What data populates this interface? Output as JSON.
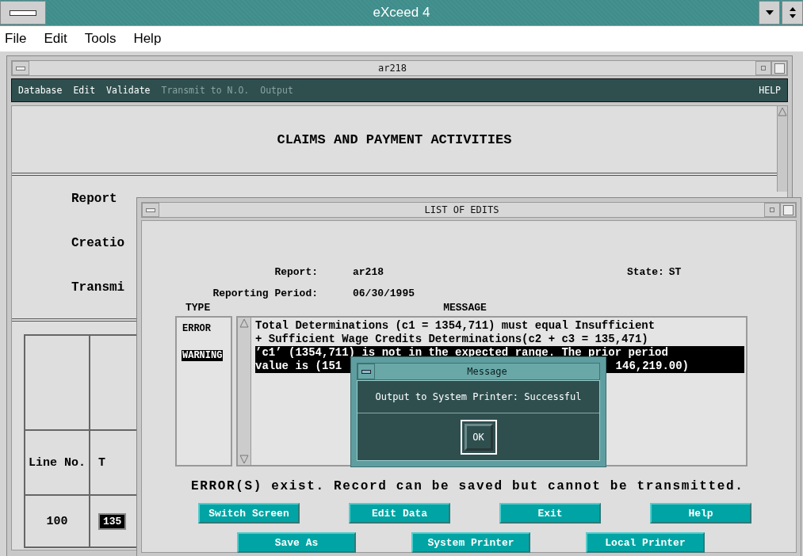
{
  "app": {
    "title": "eXceed 4",
    "menu": [
      {
        "label": "File"
      },
      {
        "label": "Edit"
      },
      {
        "label": "Tools"
      },
      {
        "label": "Help"
      }
    ]
  },
  "report_window": {
    "title": "ar218",
    "menu": [
      {
        "label": "Database",
        "disabled": false
      },
      {
        "label": "Edit",
        "disabled": false
      },
      {
        "label": "Validate",
        "disabled": false
      },
      {
        "label": "Transmit to N.O.",
        "disabled": true
      },
      {
        "label": "Output",
        "disabled": true
      }
    ],
    "help": "HELP",
    "heading": "CLAIMS AND PAYMENT ACTIVITIES",
    "labels": [
      "Report",
      "Creatio",
      "Transmi"
    ],
    "table": {
      "columns": [
        "Line No.",
        "T"
      ],
      "rows": [
        {
          "line": "100",
          "value": "135"
        }
      ]
    }
  },
  "edits_window": {
    "title": "LIST OF EDITS",
    "report_label": "Report:",
    "report": "ar218",
    "state_label": "State:",
    "state": "ST",
    "period_label": "Reporting Period:",
    "period": "06/30/1995",
    "type_header": "TYPE",
    "message_header": "MESSAGE",
    "edits": [
      {
        "type": "ERROR",
        "selected": false,
        "lines": [
          [
            "Total Determinations (c1 = 1354,711) must equal Insufficient"
          ],
          [
            "+ Sufficient Wage Credits Determinations(c2 + c3 = 135,471)"
          ]
        ]
      },
      {
        "type": "WARNING",
        "selected": true,
        "lines": [
          [
            "’c1’ (1354,711) is not in the expected range. The prior period"
          ],
          [
            "value is (151",
            "146,219.00)"
          ]
        ]
      }
    ],
    "status": "ERROR(S) exist. Record can be saved but cannot be transmitted.",
    "buttons": [
      [
        "Switch Screen",
        "Edit Data",
        "Exit",
        "Help"
      ],
      [
        "Save As",
        "System Printer",
        "Local Printer"
      ]
    ]
  },
  "message_dialog": {
    "title": "Message",
    "text": "Output to System Printer: Successful",
    "button": "OK"
  }
}
